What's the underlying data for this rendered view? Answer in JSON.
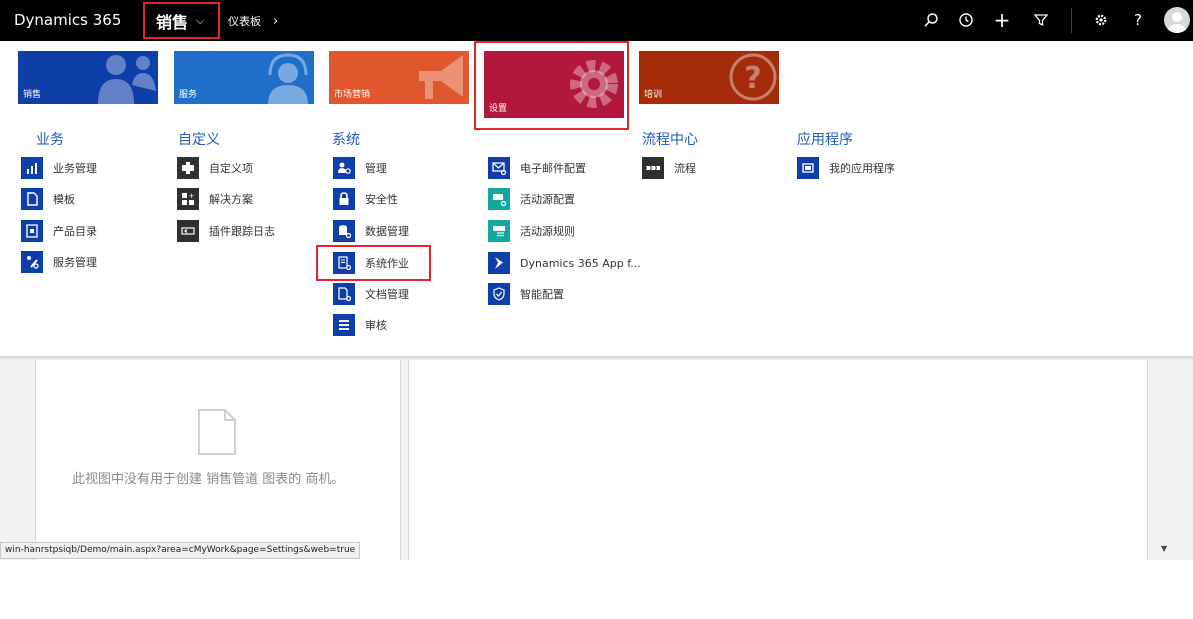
{
  "topbar": {
    "brand": "Dynamics 365",
    "area": "销售",
    "area_chevron": "⌵",
    "breadcrumb": "仪表板",
    "breadcrumb_arrow": "›",
    "icons": [
      "search-icon",
      "history-icon",
      "add-icon",
      "filter-icon",
      "settings-gear-icon",
      "help-icon",
      "user-avatar"
    ],
    "help_glyph": "?",
    "add_glyph": "+"
  },
  "tiles": [
    {
      "label": "销售",
      "color": "#0e3ea8"
    },
    {
      "label": "服务",
      "color": "#1f6fc9"
    },
    {
      "label": "市场营销",
      "color": "#e0572d"
    },
    {
      "label": "设置",
      "color": "#b2173c"
    },
    {
      "label": "培训",
      "color": "#a52b0a"
    }
  ],
  "groups": {
    "business": {
      "title": "业务",
      "items": [
        "业务管理",
        "模板",
        "产品目录",
        "服务管理"
      ]
    },
    "customization": {
      "title": "自定义",
      "items": [
        "自定义项",
        "解决方案",
        "插件跟踪日志"
      ]
    },
    "system": {
      "title": "系统",
      "items": [
        "管理",
        "安全性",
        "数据管理",
        "系统作业",
        "文档管理",
        "审核"
      ]
    },
    "system2": {
      "items": [
        "电子邮件配置",
        "活动源配置",
        "活动源规则",
        "Dynamics 365 App f...",
        "智能配置"
      ]
    },
    "process_center": {
      "title": "流程中心",
      "items": [
        "流程"
      ]
    },
    "applications": {
      "title": "应用程序",
      "items": [
        "我的应用程序"
      ]
    }
  },
  "dashboard": {
    "empty_message": "此视图中没有用于创建 销售管道 图表的 商机。"
  },
  "statusbar": {
    "url": "win-hanrstpsiqb/Demo/main.aspx?area=cMyWork&page=Settings&web=true"
  },
  "colors": {
    "accent_blue": "#0e3ea8",
    "group_title": "#1e5bc6",
    "highlight": "#e3262a"
  }
}
